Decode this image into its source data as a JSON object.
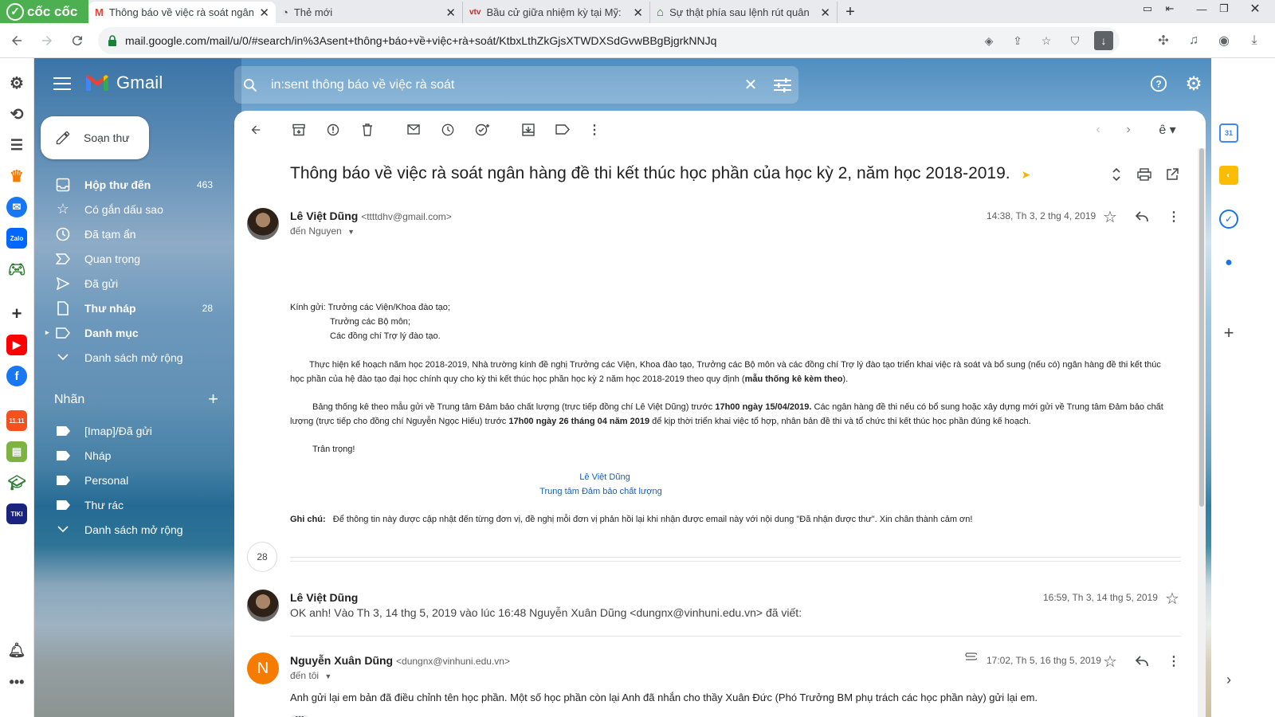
{
  "browser": {
    "brand": "cốc cốc",
    "tabs": [
      {
        "title": "Thông báo về việc rà soát ngân hàng",
        "icon": "gmail-icon",
        "active": true
      },
      {
        "title": "Thẻ mới",
        "icon": "newtab-icon",
        "active": false
      },
      {
        "title": "Bầu cử giữa nhiệm kỳ tại Mỹ:",
        "icon": "news-icon",
        "active": false
      },
      {
        "title": "Sự thật phía sau lệnh rút quân",
        "icon": "home-icon",
        "active": false
      }
    ],
    "url": "mail.google.com/mail/u/0/#search/in%3Asent+thông+báo+về+việc+rà+soát/KtbxLthZkGjsXTWDXSdGvwBBgBjgrkNNJq"
  },
  "gmail": {
    "logo_text": "Gmail",
    "search_value": "in:sent thông báo về việc rà soát",
    "compose_label": "Soạn thư",
    "nav": [
      {
        "label": "Hộp thư đến",
        "count": "463",
        "bold": true,
        "icon": "inbox-icon"
      },
      {
        "label": "Có gắn dấu sao",
        "count": "",
        "bold": false,
        "icon": "star-icon"
      },
      {
        "label": "Đã tạm ẩn",
        "count": "",
        "bold": false,
        "icon": "clock-icon"
      },
      {
        "label": "Quan trọng",
        "count": "",
        "bold": false,
        "icon": "important-icon"
      },
      {
        "label": "Đã gửi",
        "count": "",
        "bold": false,
        "icon": "send-icon"
      },
      {
        "label": "Thư nháp",
        "count": "28",
        "bold": true,
        "icon": "draft-icon"
      },
      {
        "label": "Danh mục",
        "count": "",
        "bold": true,
        "icon": "label-icon"
      },
      {
        "label": "Danh sách mở rộng",
        "count": "",
        "bold": false,
        "icon": "chevron-down-icon"
      }
    ],
    "labels_title": "Nhãn",
    "labels": [
      {
        "label": "[Imap]/Đã gửi"
      },
      {
        "label": "Nháp"
      },
      {
        "label": "Personal"
      },
      {
        "label": "Thư rác"
      },
      {
        "label": "Danh sách mở rộng"
      }
    ]
  },
  "thread": {
    "subject": "Thông báo về việc rà soát ngân hàng đề thi kết thúc học phần của học kỳ 2, năm học 2018-2019.",
    "msg1": {
      "sender": "Lê Việt Dũng",
      "email": "<ttttdhv@gmail.com>",
      "to": "đến Nguyen",
      "date": "14:38, Th 3, 2 thg 4, 2019",
      "greet1": "Kính gửi: Trưởng các Viện/Khoa đào tạo;",
      "greet2": "Trưởng các Bộ môn;",
      "greet3": "Các đồng chí Trợ lý đào tạo.",
      "p1": "Thực hiện kế hoạch năm học 2018-2019, Nhà trường kính đề nghị Trưởng các Viện, Khoa đào tạo, Trưởng các Bộ môn và các đồng chí Trợ lý đào tạo triển khai việc rà soát và bổ sung (nếu có) ngân hàng đề thi kết thúc học phần của hệ đào tạo đại học chính quy cho kỳ thi kết thúc học phần học kỳ 2 năm học 2018-2019 theo quy định (",
      "p1_bold": "mẫu thống kê kèm theo",
      "p1_end": ").",
      "p2a": "Bảng thống kê theo mẫu gửi về Trung tâm Đảm bảo chất lượng (trực tiếp đồng chí Lê Việt Dũng) trước ",
      "p2b": "17h00 ngày 15/04/2019.",
      "p2c": " Các ngân hàng đề thi nếu có bổ sung hoặc xây dựng mới gửi về Trung tâm Đảm bảo chất lượng (trực tiếp cho đồng chí Nguyễn Ngọc Hiếu) trước ",
      "p2d": "17h00 ngày 26 tháng 04 năm 2019",
      "p2e": " để kịp thời triển khai việc tổ hợp, nhân bản đề thi và tổ chức thi kết thúc học phần đúng kế hoạch.",
      "closing": "Trân trọng!",
      "sig1": "Lê Việt Dũng",
      "sig2": "Trung tâm Đảm bảo chất lượng",
      "note_label": "Ghi chú:",
      "note": "Để thông tin này được cập nhật đến từng đơn vị, đề nghị mỗi đơn vị phản hồi lại khi nhận được email này với nội dung \"Đã nhận được thư\". Xin chân thành cảm ơn!"
    },
    "collapsed_count": "28",
    "msg2": {
      "sender": "Lê Việt Dũng",
      "snippet": "OK anh! Vào Th 3, 14 thg 5, 2019 vào lúc 16:48 Nguyễn Xuân Dũng <dungnx@vinhuni.edu.vn> đã viết:",
      "date": "16:59, Th 3, 14 thg 5, 2019"
    },
    "msg3": {
      "avatar_letter": "N",
      "sender": "Nguyễn Xuân Dũng",
      "email": "<dungnx@vinhuni.edu.vn>",
      "to": "đến tôi",
      "date": "17:02, Th 5, 16 thg 5, 2019",
      "body": "Anh gửi lại em bản đã điều chỉnh tên học phần. Một số học phần còn lại Anh đã nhắn cho thầy Xuân Đức (Phó Trưởng BM phụ trách các học phần này) gửi lại em.",
      "dots": "•••"
    }
  },
  "colors": {
    "accent": "#1a73e8",
    "brand_green": "#4caf50",
    "avatar_orange": "#f57c00"
  }
}
